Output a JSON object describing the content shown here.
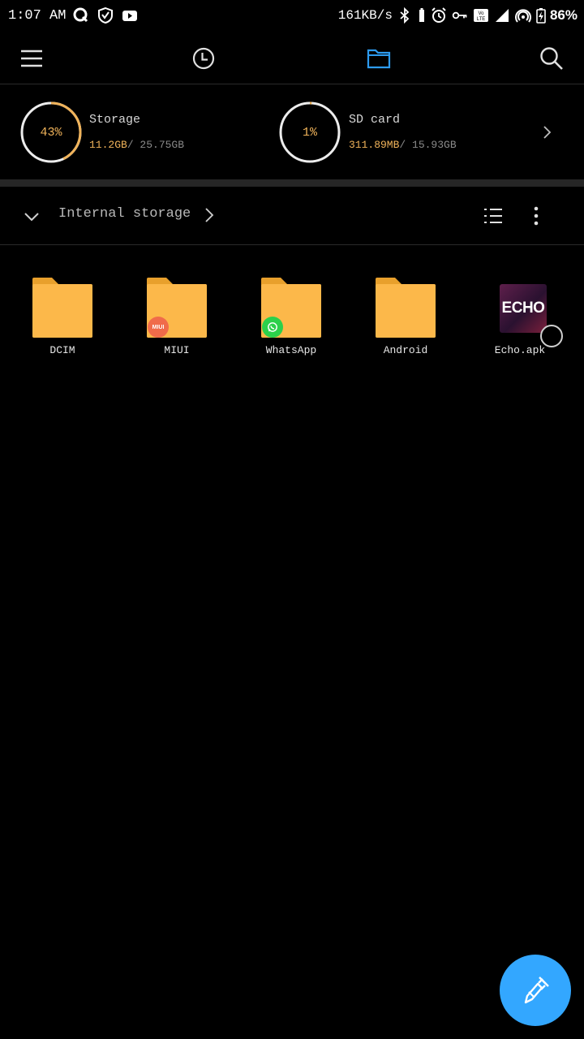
{
  "status_bar": {
    "time": "1:07 AM",
    "net_speed": "161KB/s",
    "battery": "86%",
    "left_icons": [
      "q-app-icon",
      "shield-icon",
      "youtube-icon"
    ],
    "right_icons": [
      "bluetooth-icon",
      "battery-small-icon",
      "alarm-icon",
      "vpn-key-icon",
      "volte-icon",
      "signal-icon",
      "hotspot-icon",
      "battery-charging-icon"
    ]
  },
  "toolbar": {
    "menu_icon": "hamburger-icon",
    "recent_icon": "clock-icon",
    "files_icon": "folder-icon",
    "search_icon": "search-icon",
    "active_color": "#2d9bf0"
  },
  "storage": {
    "internal": {
      "percent_label": "43%",
      "percent": 0.43,
      "title": "Storage",
      "used": "11.2GB",
      "total": "/ 25.75GB"
    },
    "sd": {
      "percent_label": "1%",
      "percent": 0.01,
      "title": "SD card",
      "used": "311.89MB",
      "total": "/ 15.93GB"
    },
    "accent": "#f0b35a"
  },
  "path_bar": {
    "label": "Internal storage"
  },
  "files": [
    {
      "name": "DCIM",
      "kind": "folder",
      "badge": null
    },
    {
      "name": "MIUI",
      "kind": "folder",
      "badge": "MIUI"
    },
    {
      "name": "WhatsApp",
      "kind": "folder",
      "badge": "whatsapp"
    },
    {
      "name": "Android",
      "kind": "folder",
      "badge": null
    },
    {
      "name": "Echo.apk",
      "kind": "apk",
      "thumb_text": "ECHO"
    }
  ],
  "fab": {
    "icon": "broom-clean-icon",
    "color": "#33a7ff"
  }
}
